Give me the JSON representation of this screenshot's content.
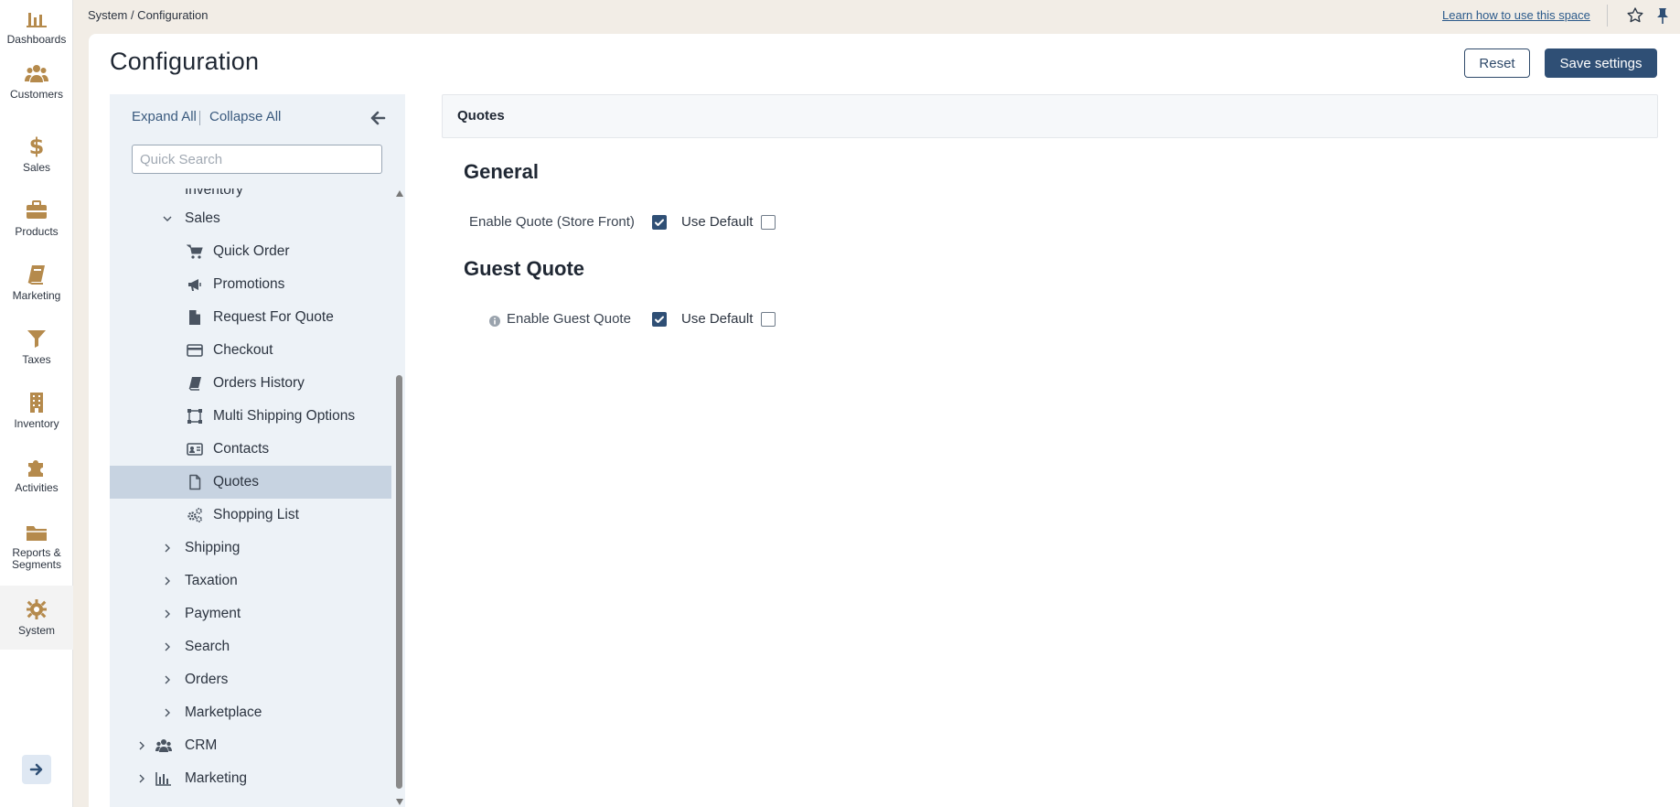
{
  "nav": {
    "items": [
      {
        "label": "Dashboards",
        "icon": "chart-bar-icon"
      },
      {
        "label": "Customers",
        "icon": "users-icon"
      },
      {
        "label": "Sales",
        "icon": "dollar-icon"
      },
      {
        "label": "Products",
        "icon": "briefcase-icon"
      },
      {
        "label": "Marketing",
        "icon": "book-icon"
      },
      {
        "label": "Taxes",
        "icon": "filter-icon"
      },
      {
        "label": "Inventory",
        "icon": "building-icon"
      },
      {
        "label": "Activities",
        "icon": "puzzle-icon"
      },
      {
        "label": "Reports &",
        "label2": "Segments",
        "icon": "folder-icon"
      },
      {
        "label": "System",
        "icon": "gear-icon"
      }
    ],
    "accent_color": "#b58a4c"
  },
  "topbar": {
    "breadcrumb": "System / Configuration",
    "learn_link": "Learn how to use this space"
  },
  "page": {
    "title": "Configuration",
    "reset_label": "Reset",
    "save_label": "Save settings"
  },
  "tree": {
    "expand_all": "Expand All",
    "collapse_all": "Collapse All",
    "search_placeholder": "Quick Search",
    "items": [
      {
        "label": "Inventory"
      },
      {
        "label": "Sales"
      },
      {
        "label": "Quick Order"
      },
      {
        "label": "Promotions"
      },
      {
        "label": "Request For Quote"
      },
      {
        "label": "Checkout"
      },
      {
        "label": "Orders History"
      },
      {
        "label": "Multi Shipping Options"
      },
      {
        "label": "Contacts"
      },
      {
        "label": "Quotes"
      },
      {
        "label": "Shopping List"
      },
      {
        "label": "Shipping"
      },
      {
        "label": "Taxation"
      },
      {
        "label": "Payment"
      },
      {
        "label": "Search"
      },
      {
        "label": "Orders"
      },
      {
        "label": "Marketplace"
      },
      {
        "label": "CRM"
      },
      {
        "label": "Marketing"
      }
    ]
  },
  "content": {
    "section_title": "Quotes",
    "groups": [
      {
        "title": "General",
        "fields": [
          {
            "label": "Enable Quote (Store Front)",
            "checked": true,
            "use_default_label": "Use Default",
            "use_default": false
          }
        ]
      },
      {
        "title": "Guest Quote",
        "fields": [
          {
            "label": "Enable Guest Quote",
            "checked": true,
            "use_default_label": "Use Default",
            "use_default": false
          }
        ]
      }
    ]
  }
}
